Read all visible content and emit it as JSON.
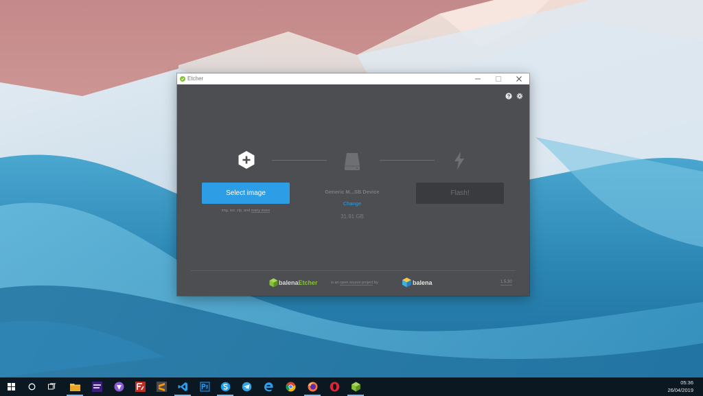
{
  "window": {
    "title": "Etcher",
    "controls": {
      "minimize": "minimize",
      "maximize": "maximize",
      "close": "close"
    }
  },
  "header": {
    "help_icon": "help-icon",
    "settings_icon": "gear-icon"
  },
  "steps": {
    "image": {
      "icon": "plus-icon",
      "button_label": "Select image",
      "formats_text": "img, iso, zip, and ",
      "formats_more": "many more"
    },
    "drive": {
      "icon": "drive-icon",
      "name": "Generic M...SB Device",
      "change_label": "Change",
      "size": "31.91 GB"
    },
    "flash": {
      "icon": "lightning-bolt-icon",
      "button_label": "Flash!"
    }
  },
  "footer": {
    "brand_prefix": "balena",
    "brand_product": "Etcher",
    "tagline_prefix": "is an ",
    "tagline_link": "open source project",
    "tagline_suffix": " by",
    "company": "balena",
    "version": "1.5.30"
  },
  "taskbar": {
    "items": [
      {
        "name": "start-icon"
      },
      {
        "name": "cortana-icon"
      },
      {
        "name": "task-view-icon"
      },
      {
        "name": "file-explorer-icon"
      },
      {
        "name": "app-icon"
      },
      {
        "name": "app-icon"
      },
      {
        "name": "filezilla-icon"
      },
      {
        "name": "sublime-text-icon"
      },
      {
        "name": "vscode-icon"
      },
      {
        "name": "photoshop-icon"
      },
      {
        "name": "skype-icon"
      },
      {
        "name": "telegram-icon"
      },
      {
        "name": "edge-icon"
      },
      {
        "name": "chrome-icon"
      },
      {
        "name": "firefox-icon"
      },
      {
        "name": "opera-icon"
      },
      {
        "name": "etcher-icon"
      }
    ],
    "time": "05:36",
    "date": "26/04/2019"
  },
  "colors": {
    "accent": "#2d9de6",
    "window_bg": "#4d4e51",
    "etcher_green": "#85c238",
    "taskbar": "#0b1822"
  }
}
